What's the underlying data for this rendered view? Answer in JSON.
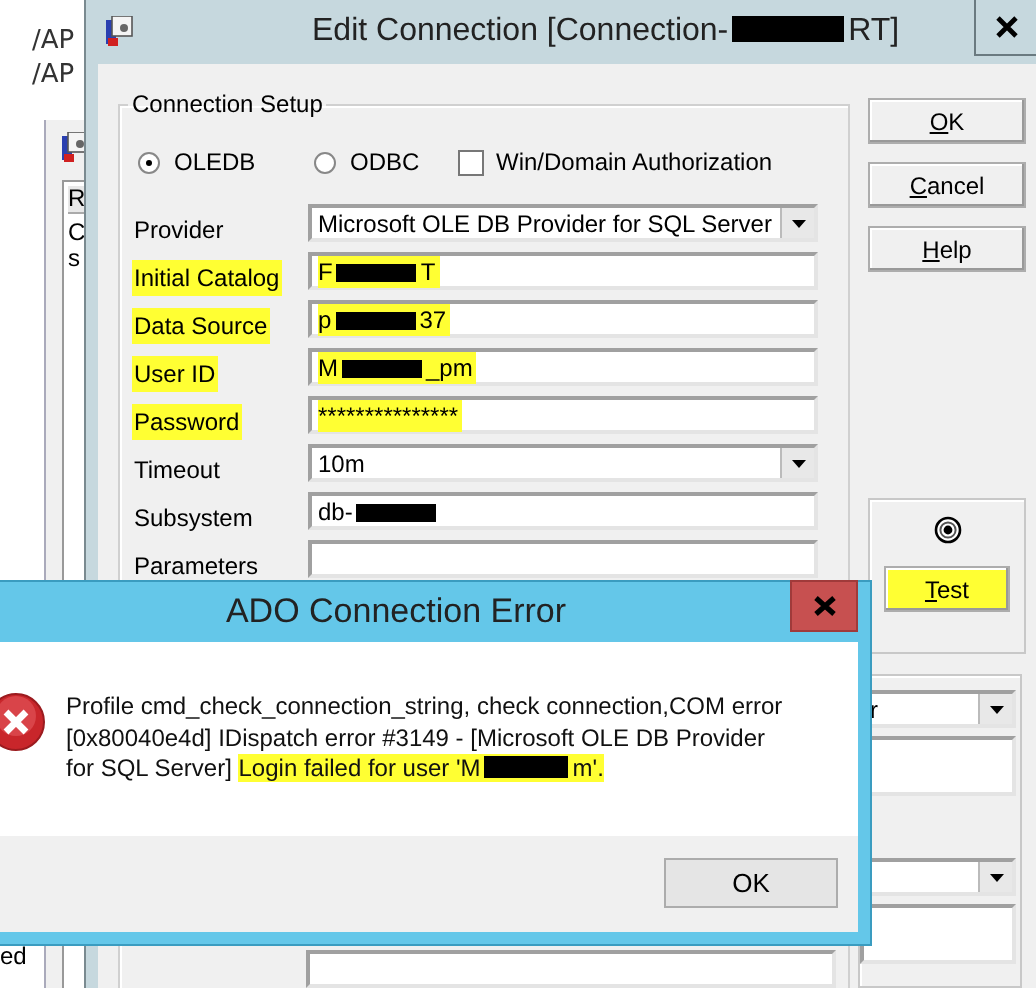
{
  "desktop": {
    "path_lines": [
      "/AP",
      "/AP"
    ],
    "fragments": [
      "R",
      "C",
      "s",
      "ed"
    ]
  },
  "edit_window": {
    "title_start": "Edit Connection [Connection-",
    "title_end": "RT]",
    "group_title": "Connection Setup",
    "modes": [
      {
        "label": "OLEDB",
        "selected": true
      },
      {
        "label": "ODBC",
        "selected": false
      }
    ],
    "win_auth": {
      "label": "Win/Domain Authorization",
      "checked": false
    },
    "fields": [
      {
        "kind": "dropdown",
        "label": "Provider",
        "value": "Microsoft OLE DB Provider for SQL Server",
        "highlighted": false,
        "redacted": false
      },
      {
        "kind": "text",
        "label": "Initial Catalog",
        "value": "F",
        "value_end": "T",
        "highlighted": true,
        "redacted": true
      },
      {
        "kind": "text",
        "label": "Data Source",
        "value": "p",
        "value_end": "37",
        "highlighted": true,
        "redacted": true
      },
      {
        "kind": "text",
        "label": "User ID",
        "value": "M",
        "value_end": "_pm",
        "highlighted": true,
        "redacted": true
      },
      {
        "kind": "text",
        "label": "Password",
        "value": "***************",
        "highlighted": true,
        "redacted": false
      },
      {
        "kind": "dropdown",
        "label": "Timeout",
        "value": "10m",
        "highlighted": false,
        "redacted": false
      },
      {
        "kind": "text",
        "label": "Subsystem",
        "value": "db-",
        "highlighted": false,
        "redacted": true
      },
      {
        "kind": "text",
        "label": "Parameters",
        "highlighted": false,
        "redacted": false
      }
    ],
    "buttons": [
      {
        "label": "OK",
        "highlighted": false
      },
      {
        "label": "Cancel",
        "highlighted": false
      },
      {
        "label": "Help",
        "highlighted": false
      }
    ],
    "test_button": {
      "label": "Test",
      "highlighted": true
    },
    "side_controls": [
      {
        "kind": "dropdown",
        "value": "r"
      },
      {
        "kind": "text"
      },
      {
        "kind": "dropdown"
      },
      {
        "kind": "text"
      }
    ]
  },
  "error_dialog": {
    "title": "ADO Connection Error",
    "message": "Profile cmd_check_connection_string, check connection,COM error [0x80040e4d] IDispatch error #3149 - [Microsoft OLE DB Provider for SQL Server] ",
    "message_highlight": "Login failed for user 'M",
    "message_highlight_end": "m'.",
    "button": "OK"
  }
}
